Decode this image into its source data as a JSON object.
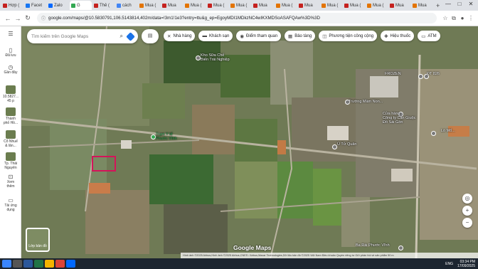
{
  "tabs": [
    {
      "label": "Hợp (",
      "color": "#c5221f"
    },
    {
      "label": "Facet",
      "color": "#1877f2"
    },
    {
      "label": "Zalo",
      "color": "#0068ff"
    },
    {
      "label": "G",
      "color": "#34a853",
      "active": true
    },
    {
      "label": "Thê (",
      "color": "#c5221f"
    },
    {
      "label": "cách",
      "color": "#4285f4"
    },
    {
      "label": "Mua (",
      "color": "#e37400"
    },
    {
      "label": "Mua",
      "color": "#c5221f"
    },
    {
      "label": "Mua (",
      "color": "#e37400"
    },
    {
      "label": "Mua (",
      "color": "#c5221f"
    },
    {
      "label": "Mua (",
      "color": "#e37400"
    },
    {
      "label": "Mua",
      "color": "#c5221f"
    },
    {
      "label": "Mua (",
      "color": "#e37400"
    },
    {
      "label": "Mua",
      "color": "#c5221f"
    },
    {
      "label": "Mua (",
      "color": "#e37400"
    },
    {
      "label": "Mua (",
      "color": "#c5221f"
    },
    {
      "label": "Mua (",
      "color": "#e37400"
    },
    {
      "label": "Mua",
      "color": "#c5221f"
    },
    {
      "label": "Mua",
      "color": "#e37400"
    }
  ],
  "address": {
    "url": "google.com/maps/@10.5830791,106.5143814,402m/data=!3m1!1e3?entry=ttu&g_ep=EgoyMDI1MDkzNC4wIKXMDSoASAFQAw%3D%3D"
  },
  "rail": [
    {
      "label": "",
      "icon": "menu-icon"
    },
    {
      "label": "Đã lưu",
      "icon": "bookmark-icon"
    },
    {
      "label": "Gần đây",
      "icon": "history-icon"
    },
    {
      "label": "10.5827...\n45 p",
      "icon": "place-thumb"
    },
    {
      "label": "Thành\nphố Hồ...",
      "icon": "place-thumb"
    },
    {
      "label": "Cổ Nhuế\n& lân...",
      "icon": "place-thumb"
    },
    {
      "label": "Tp. Thái\nNguyên",
      "icon": "place-thumb"
    },
    {
      "label": "Xem\nthêm",
      "icon": "more-icon"
    },
    {
      "label": "Tải ứng\ndụng",
      "icon": "phone-icon"
    }
  ],
  "search": {
    "placeholder": "Tìm kiếm trên Google Maps"
  },
  "chips": [
    {
      "label": "Nhà hàng",
      "icon": "restaurant-icon"
    },
    {
      "label": "Khách sạn",
      "icon": "hotel-icon"
    },
    {
      "label": "Điểm tham quan",
      "icon": "camera-icon"
    },
    {
      "label": "Bảo tàng",
      "icon": "museum-icon"
    },
    {
      "label": "Phương tiện công cộng",
      "icon": "transit-icon"
    },
    {
      "label": "Hiệu thuốc",
      "icon": "pharmacy-icon"
    },
    {
      "label": "ATM",
      "icon": "atm-icon"
    }
  ],
  "pois": [
    {
      "label": "Kho Sữa Chế\nBiến Trái Nghiệp",
      "color": "#ffffff"
    },
    {
      "label": "FROZEN",
      "color": "#ffffff"
    },
    {
      "label": "Trường Mầm Non...",
      "color": "#ffffff"
    },
    {
      "label": "Cửa hàng...\nCông ty Cần Giuộc\nĐồ Sài Gòn",
      "color": "#ffffff"
    },
    {
      "label": "Trạm Y tế\nPhước Vĩnh",
      "color": "#34a853"
    },
    {
      "label": "Lò Mổ...",
      "color": "#ffffff"
    },
    {
      "label": "Ủ Tử Quân",
      "color": "#ffffff"
    },
    {
      "label": "Ba Rài Phước Vĩnh",
      "color": "#ffffff"
    },
    {
      "label": "ĐT 826",
      "color": "#ffffff"
    }
  ],
  "layers_label": "Lớp bản đồ",
  "logo": "Google Maps",
  "attribution": "Hình ảnh ©2025 Airbus,Hình ảnh ©2025 Airbus,CNES / Airbus,Maxar Technologies,Dữ liệu bản đồ ©2025   Việt Nam   Điều khoản   Quyền riêng tư   Gửi phản hồi về sản phẩm   50 m",
  "tray": {
    "time": "03:34 PM",
    "date": "17/09/2025",
    "lang": "ENG"
  }
}
